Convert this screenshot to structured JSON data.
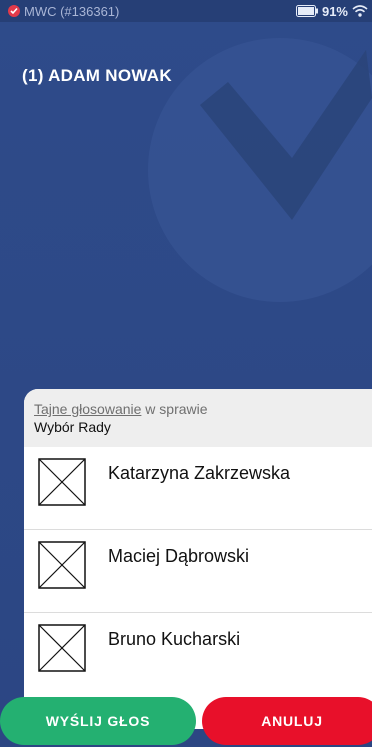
{
  "status_bar": {
    "app_label": "MWC (#136361)",
    "battery": "91%"
  },
  "header": {
    "voter_name": "(1) ADAM NOWAK"
  },
  "ballot": {
    "subtitle_underlined": "Tajne głosowanie",
    "subtitle_rest": " w sprawie",
    "title": "Wybór Rady",
    "candidates": [
      {
        "name": "Katarzyna Zakrzewska"
      },
      {
        "name": "Maciej Dąbrowski"
      },
      {
        "name": "Bruno Kucharski"
      }
    ]
  },
  "actions": {
    "send_label": "WYŚLIJ GŁOS",
    "cancel_label": "ANULUJ"
  },
  "colors": {
    "background": "#2e4b8a",
    "send": "#24b071",
    "cancel": "#e8102a"
  }
}
